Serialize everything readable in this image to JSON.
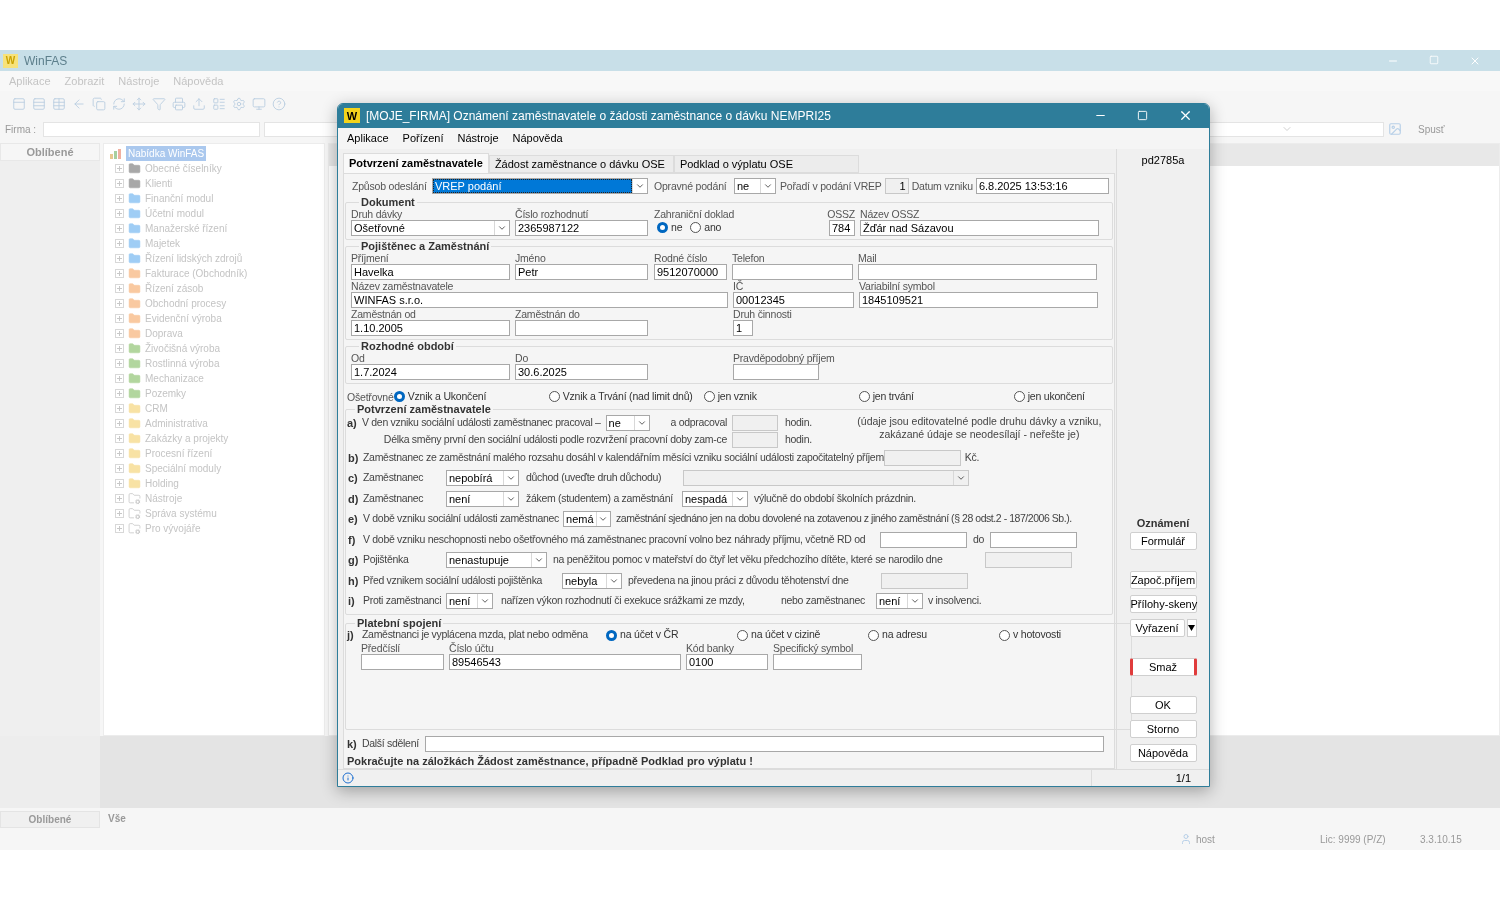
{
  "app": {
    "logo": "W",
    "title": "WinFAS",
    "menu": [
      "Aplikace",
      "Zobrazit",
      "Nástroje",
      "Nápověda"
    ],
    "firma_label": "Firma :",
    "run_button": "Spusť",
    "favorites_header": "Oblíbené",
    "tree": {
      "label": "Nabídka WinFAS",
      "selected": true,
      "children": [
        {
          "label": "Obecné číselníky",
          "kind": "folder",
          "color": "#a8a8a8",
          "expanded": false
        },
        {
          "label": "Klienti",
          "kind": "folder",
          "color": "#a8a8a8",
          "expanded": false
        },
        {
          "label": "Finanční modul",
          "kind": "folder",
          "color": "#9fcdf5",
          "expanded": false
        },
        {
          "label": "Účetní modul",
          "kind": "folder",
          "color": "#9fcdf5",
          "expanded": false
        },
        {
          "label": "Manažerské řízení",
          "kind": "folder",
          "color": "#9fcdf5",
          "expanded": false
        },
        {
          "label": "Majetek",
          "kind": "folder",
          "color": "#9fcdf5",
          "expanded": false
        },
        {
          "label": "Řízení lidských zdrojů",
          "kind": "folder",
          "color": "#9fcdf5",
          "expanded": false
        },
        {
          "label": "Fakturace (Obchodník)",
          "kind": "folder",
          "color": "#f9c9a0",
          "expanded": false
        },
        {
          "label": "Řízení zásob",
          "kind": "folder",
          "color": "#f9c9a0",
          "expanded": false
        },
        {
          "label": "Obchodní procesy",
          "kind": "folder",
          "color": "#f9c9a0",
          "expanded": false
        },
        {
          "label": "Evidenční výroba",
          "kind": "folder",
          "color": "#f9c9a0",
          "expanded": false
        },
        {
          "label": "Doprava",
          "kind": "folder",
          "color": "#f9c9a0",
          "expanded": false
        },
        {
          "label": "Živočišná výroba",
          "kind": "folder",
          "color": "#b2d69e",
          "expanded": false
        },
        {
          "label": "Rostlinná výroba",
          "kind": "folder",
          "color": "#b2d69e",
          "expanded": false
        },
        {
          "label": "Mechanizace",
          "kind": "folder",
          "color": "#b2d69e",
          "expanded": false
        },
        {
          "label": "Pozemky",
          "kind": "folder",
          "color": "#b2d69e",
          "expanded": false
        },
        {
          "label": "CRM",
          "kind": "folder",
          "color": "#f8e2a4",
          "expanded": false
        },
        {
          "label": "Administrativa",
          "kind": "folder",
          "color": "#f8e2a4",
          "expanded": false
        },
        {
          "label": "Zakázky a projekty",
          "kind": "folder",
          "color": "#f8e2a4",
          "expanded": false
        },
        {
          "label": "Procesní řízení",
          "kind": "folder",
          "color": "#f8e2a4",
          "expanded": false
        },
        {
          "label": "Speciální moduly",
          "kind": "folder",
          "color": "#f8e2a4",
          "expanded": false
        },
        {
          "label": "Holding",
          "kind": "folder",
          "color": "#f8e2a4",
          "expanded": false
        },
        {
          "label": "Nástroje",
          "kind": "tool",
          "expanded": false
        },
        {
          "label": "Správa systému",
          "kind": "tool",
          "expanded": false
        },
        {
          "label": "Pro vývojáře",
          "kind": "tool",
          "expanded": false
        }
      ]
    },
    "bottom_tabs": [
      {
        "label": "Oblíbené",
        "selected": true
      },
      {
        "label": "Vše",
        "selected": false
      }
    ],
    "status": {
      "user": "host",
      "license": "Lic: 9999 (P/Z)",
      "version": "3.3.10.15"
    }
  },
  "dialog": {
    "logo": "W",
    "title": "[MOJE_FIRMA] Oznámení zaměstnavatele o žádosti zaměstnance o dávku NEMPRI25",
    "menu": [
      "Aplikace",
      "Pořízení",
      "Nástroje",
      "Nápověda"
    ],
    "tabs": [
      {
        "label": "Potvrzení zaměstnavatele",
        "selected": true
      },
      {
        "label": "Žádost zaměstnance o dávku OSE",
        "selected": false
      },
      {
        "label": "Podklad o výplatu OSE",
        "selected": false
      }
    ],
    "header": {
      "send_label": "Způsob odeslání",
      "send_value": "VREP podání",
      "send_highlighted": true,
      "correction_label": "Opravné podání",
      "correction_value": "ne",
      "order_label": "Pořadí v podání VREP",
      "order_value": "1",
      "created_label": "Datum vzniku",
      "created_value": "6.8.2025 13:53:16"
    },
    "document": {
      "legend": "Dokument",
      "benefit_type": {
        "label": "Druh dávky",
        "value": "Ošetřovné"
      },
      "decision_no": {
        "label": "Číslo rozhodnutí",
        "value": "2365987122"
      },
      "foreign": {
        "label": "Zahraniční doklad",
        "options": [
          {
            "label": "ne",
            "selected": true
          },
          {
            "label": "ano",
            "selected": false
          }
        ]
      },
      "ossz": {
        "label": "OSSZ",
        "value": "784"
      },
      "ossz_name": {
        "label": "Název OSSZ",
        "value": "Žďár nad Sázavou"
      }
    },
    "insured": {
      "legend": "Pojištěnec a Zaměstnání",
      "surname": {
        "label": "Příjmení",
        "value": "Havelka"
      },
      "first_name": {
        "label": "Jméno",
        "value": "Petr"
      },
      "birth_no": {
        "label": "Rodné číslo",
        "value": "9512070000"
      },
      "phone": {
        "label": "Telefon"
      },
      "mail": {
        "label": "Mail"
      },
      "employer": {
        "label": "Název zaměstnavatele",
        "value": "WINFAS s.r.o."
      },
      "ic": {
        "label": "IČ",
        "value": "00012345"
      },
      "var_symbol": {
        "label": "Variabilní symbol",
        "value": "1845109521"
      },
      "employed_from": {
        "label": "Zaměstnán od",
        "value": "1.10.2005"
      },
      "employed_to": {
        "label": "Zaměstnán do"
      },
      "activity": {
        "label": "Druh činnosti",
        "value": "1"
      }
    },
    "period": {
      "legend": "Rozhodné období",
      "from": {
        "label": "Od",
        "value": "1.7.2024"
      },
      "to": {
        "label": "Do",
        "value": "30.6.2025"
      },
      "income": {
        "label": "Pravděpodobný příjem"
      }
    },
    "care": {
      "label": "Ošetřovné",
      "options": [
        {
          "label": "Vznik a Ukončení",
          "selected": true
        },
        {
          "label": "Vznik a Trvání (nad limit dnů)",
          "selected": false
        },
        {
          "label": "jen vznik",
          "selected": false
        },
        {
          "label": "jen trvání",
          "selected": false
        },
        {
          "label": "jen ukončení",
          "selected": false
        }
      ]
    },
    "confirmation": {
      "legend": "Potvrzení zaměstnavatele",
      "a": {
        "letter": "a)",
        "text": "V den vzniku sociální události zaměstnanec pracoval –",
        "select": "ne",
        "after": "a odpracoval",
        "unit": "hodin.",
        "disabled": true,
        "text2": "Délka směny první den sociální události podle rozvržení pracovní doby zam-ce",
        "unit2": "hodin.",
        "note": "(údaje jsou editovatelné podle druhu dávky a vzniku, zakázané údaje se neodesílají - neřešte je)"
      },
      "b": {
        "letter": "b)",
        "text": "Zaměstnanec ze zaměstnání malého rozsahu dosáhl v kalendářním měsíci vzniku sociální události započitatelný příjem",
        "unit": "Kč.",
        "disabled": true
      },
      "c": {
        "letter": "c)",
        "text": "Zaměstnanec",
        "select": "nepobírá",
        "after": "důchod (uveďte druh důchodu)",
        "disabled": true
      },
      "d": {
        "letter": "d)",
        "text": "Zaměstnanec",
        "select": "není",
        "after": "žákem (studentem) a zaměstnání",
        "select2": "nespadá",
        "after2": "výlučně do období školních prázdnin."
      },
      "e": {
        "letter": "e)",
        "text": "V době vzniku sociální události zaměstnanec",
        "select": "nemá",
        "after": "zaměstnání sjednáno jen na dobu dovolené na zotavenou z jiného zaměstnání (§ 28 odst.2 - 187/2006 Sb.)."
      },
      "f": {
        "letter": "f)",
        "text": "V době vzniku neschopnosti nebo ošetřovného má zaměstnanec pracovní volno bez náhrady příjmu, včetně RD od",
        "to": "do"
      },
      "g": {
        "letter": "g)",
        "text": "Pojištěnka",
        "select": "nenastupuje",
        "after": "na peněžitou pomoc v mateřství do čtyř let věku předchozího dítěte,  které se narodilo dne",
        "disabled": true
      },
      "h": {
        "letter": "h)",
        "text": "Před vznikem sociální události pojištěnka",
        "select": "nebyla",
        "after": "převedena na jinou práci z důvodu těhotenství dne",
        "disabled": true
      },
      "i": {
        "letter": "i)",
        "text": "Proti zaměstnanci",
        "select": "není",
        "after": "nařízen výkon rozhodnutí či exekuce srážkami ze mzdy,",
        "after2": "nebo zaměstnanec",
        "select2": "není",
        "after3": "v insolvenci."
      }
    },
    "payment": {
      "legend": "Platební spojení",
      "letter": "j)",
      "text": "Zaměstnanci je vyplácena mzda, plat nebo odměna",
      "options": [
        {
          "label": "na účet v ČR",
          "selected": true
        },
        {
          "label": "na účet v cizině",
          "selected": false
        },
        {
          "label": "na adresu",
          "selected": false
        },
        {
          "label": "v hotovosti",
          "selected": false
        }
      ],
      "prefix": {
        "label": "Předčíslí"
      },
      "account": {
        "label": "Číslo účtu",
        "value": "89546543"
      },
      "bank": {
        "label": "Kód banky",
        "value": "0100"
      },
      "specific": {
        "label": "Specifický symbol"
      }
    },
    "other": {
      "letter": "k)",
      "label": "Další sdělení"
    },
    "note": "Pokračujte na záložkách Žádost zaměstnance, případně Podklad pro výplatu !",
    "page": "1/1",
    "sidebar": {
      "code": "pd2785a",
      "section": "Oznámení",
      "groups": [
        [
          {
            "label": "Formulář",
            "kind": "plain"
          }
        ],
        [
          {
            "label": "Započ.příjem",
            "kind": "plain"
          },
          {
            "label": "Přílohy-skeny",
            "kind": "plain"
          },
          {
            "label": "Vyřazení",
            "kind": "split"
          }
        ],
        [
          {
            "label": "Smaž",
            "kind": "danger"
          }
        ],
        [
          {
            "label": "OK",
            "kind": "plain"
          },
          {
            "label": "Storno",
            "kind": "plain"
          },
          {
            "label": "Nápověda",
            "kind": "plain"
          }
        ]
      ]
    }
  }
}
